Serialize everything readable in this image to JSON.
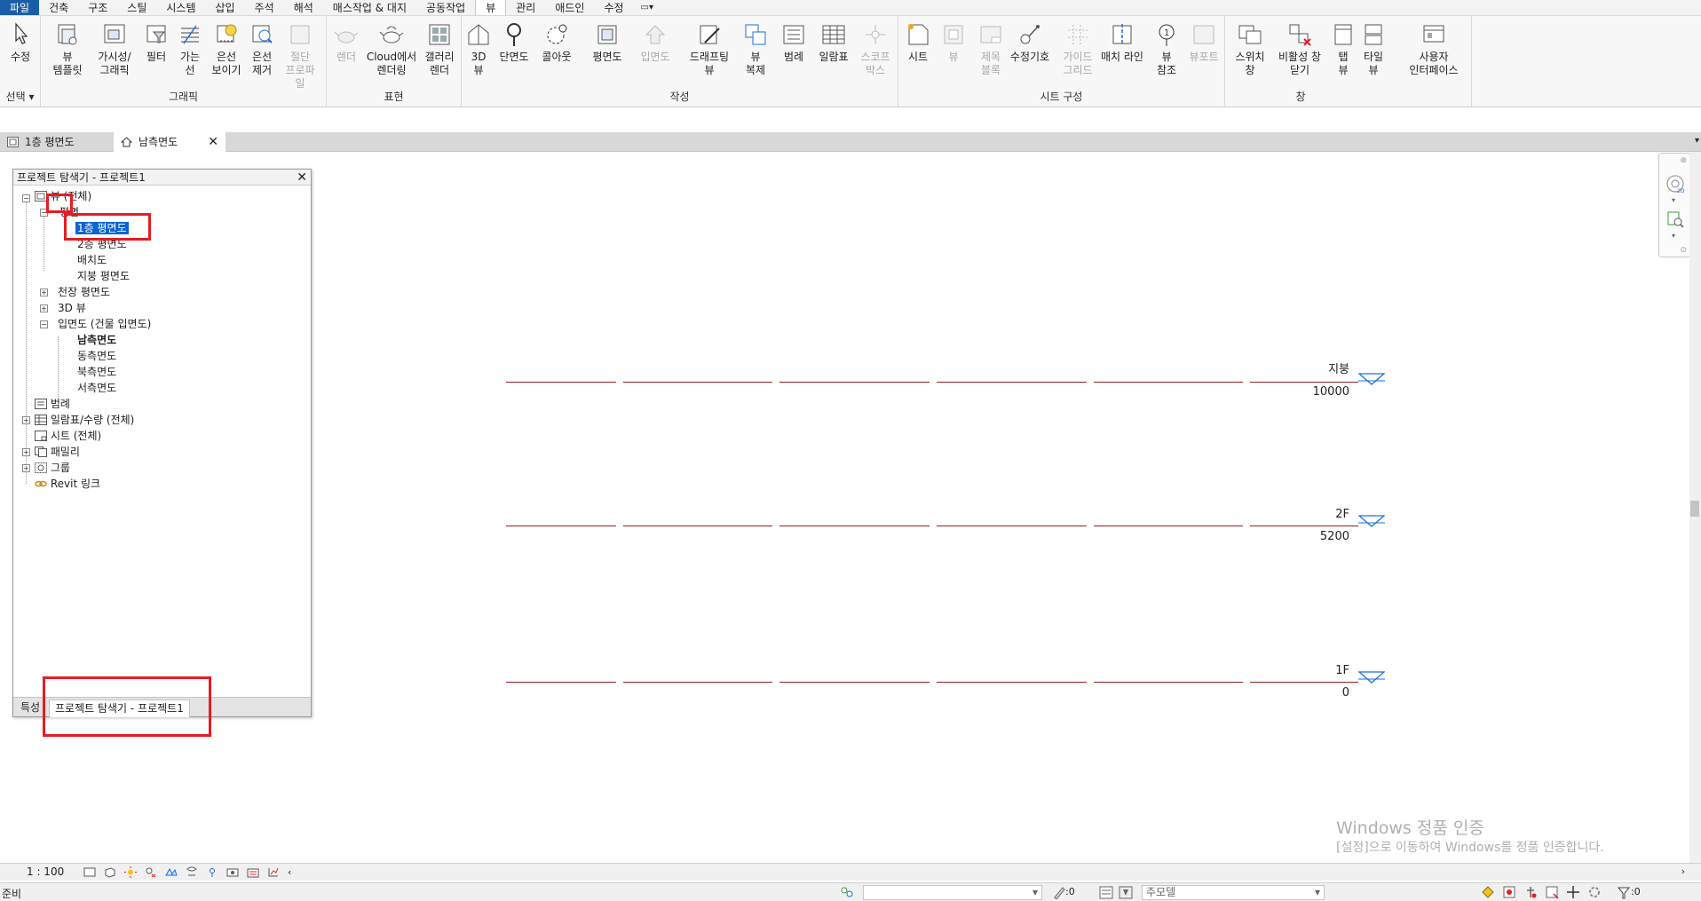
{
  "menu": {
    "tabs": [
      "파일",
      "건축",
      "구조",
      "스틸",
      "시스템",
      "삽입",
      "주석",
      "해석",
      "매스작업 & 대지",
      "공동작업",
      "뷰",
      "관리",
      "애드인",
      "수정"
    ],
    "active": "뷰"
  },
  "ribbon": {
    "select": {
      "modify": "수정",
      "label": "선택"
    },
    "graphics": {
      "label": "그래픽",
      "buttons": [
        "뷰\n템플릿",
        "가시성/\n그래픽",
        "필터",
        "가는\n선",
        "은선\n보이기",
        "은선\n제거",
        "절단\n프로파일"
      ]
    },
    "presentation": {
      "label": "표현",
      "buttons": [
        "렌더",
        "Cloud에서\n렌더링",
        "갤러리\n렌더"
      ]
    },
    "create": {
      "label": "작성",
      "buttons": [
        "3D\n뷰",
        "단면도",
        "콜아웃",
        "평면도",
        "입면도",
        "드래프팅\n뷰",
        "뷰\n복제",
        "범례",
        "일람표",
        "스코프\n박스"
      ]
    },
    "sheet": {
      "label": "시트 구성",
      "buttons": [
        "시트",
        "뷰",
        "제목\n블록",
        "수정기호",
        "가이드\n그리드",
        "매치 라인",
        "뷰\n참조",
        "뷰포트"
      ]
    },
    "windows": {
      "label": "창",
      "buttons": [
        "스위치\n창",
        "비활성 창\n닫기",
        "탭\n뷰",
        "타일\n뷰",
        "사용자\n인터페이스"
      ]
    }
  },
  "view_tabs": [
    {
      "label": "1층 평면도",
      "active": false
    },
    {
      "label": "남측면도",
      "active": true
    }
  ],
  "browser": {
    "title": "프로젝트 탐색기 - 프로젝트1",
    "tree": {
      "views_root": "뷰 (전체)",
      "floor_plans": "평면",
      "floor_plan_items": [
        "1층 평면도",
        "2층 평면도",
        "배치도",
        "지붕 평면도"
      ],
      "ceiling_plans": "천장 평면도",
      "views_3d": "3D 뷰",
      "elevations": "입면도 (건물 입면도)",
      "elevation_items": [
        "남측면도",
        "동측면도",
        "북측면도",
        "서측면도"
      ],
      "legends": "범례",
      "schedules": "일람표/수량 (전체)",
      "sheets": "시트 (전체)",
      "families": "패밀리",
      "groups": "그룹",
      "revit_links": "Revit 링크"
    },
    "bottom_tabs": [
      "특성",
      "프로젝트 탐색기 - 프로젝트1"
    ]
  },
  "levels": [
    {
      "name": "지붕",
      "elevation": "10000"
    },
    {
      "name": "2F",
      "elevation": "5200"
    },
    {
      "name": "1F",
      "elevation": "0"
    }
  ],
  "watermark": {
    "line1": "Windows 정품 인증",
    "line2": "[설정]으로 이동하여 Windows를 정품 인증합니다."
  },
  "view_control": {
    "scale": "1 : 100"
  },
  "status": {
    "text": "준비",
    "worksets_count": ":0",
    "design_option": "주모델",
    "filter_count": ":0"
  },
  "colors": {
    "accent": "#1b5ea8",
    "level_line": "#8b2222",
    "level_marker": "#1e6fd9",
    "highlight": "#e61c24"
  }
}
